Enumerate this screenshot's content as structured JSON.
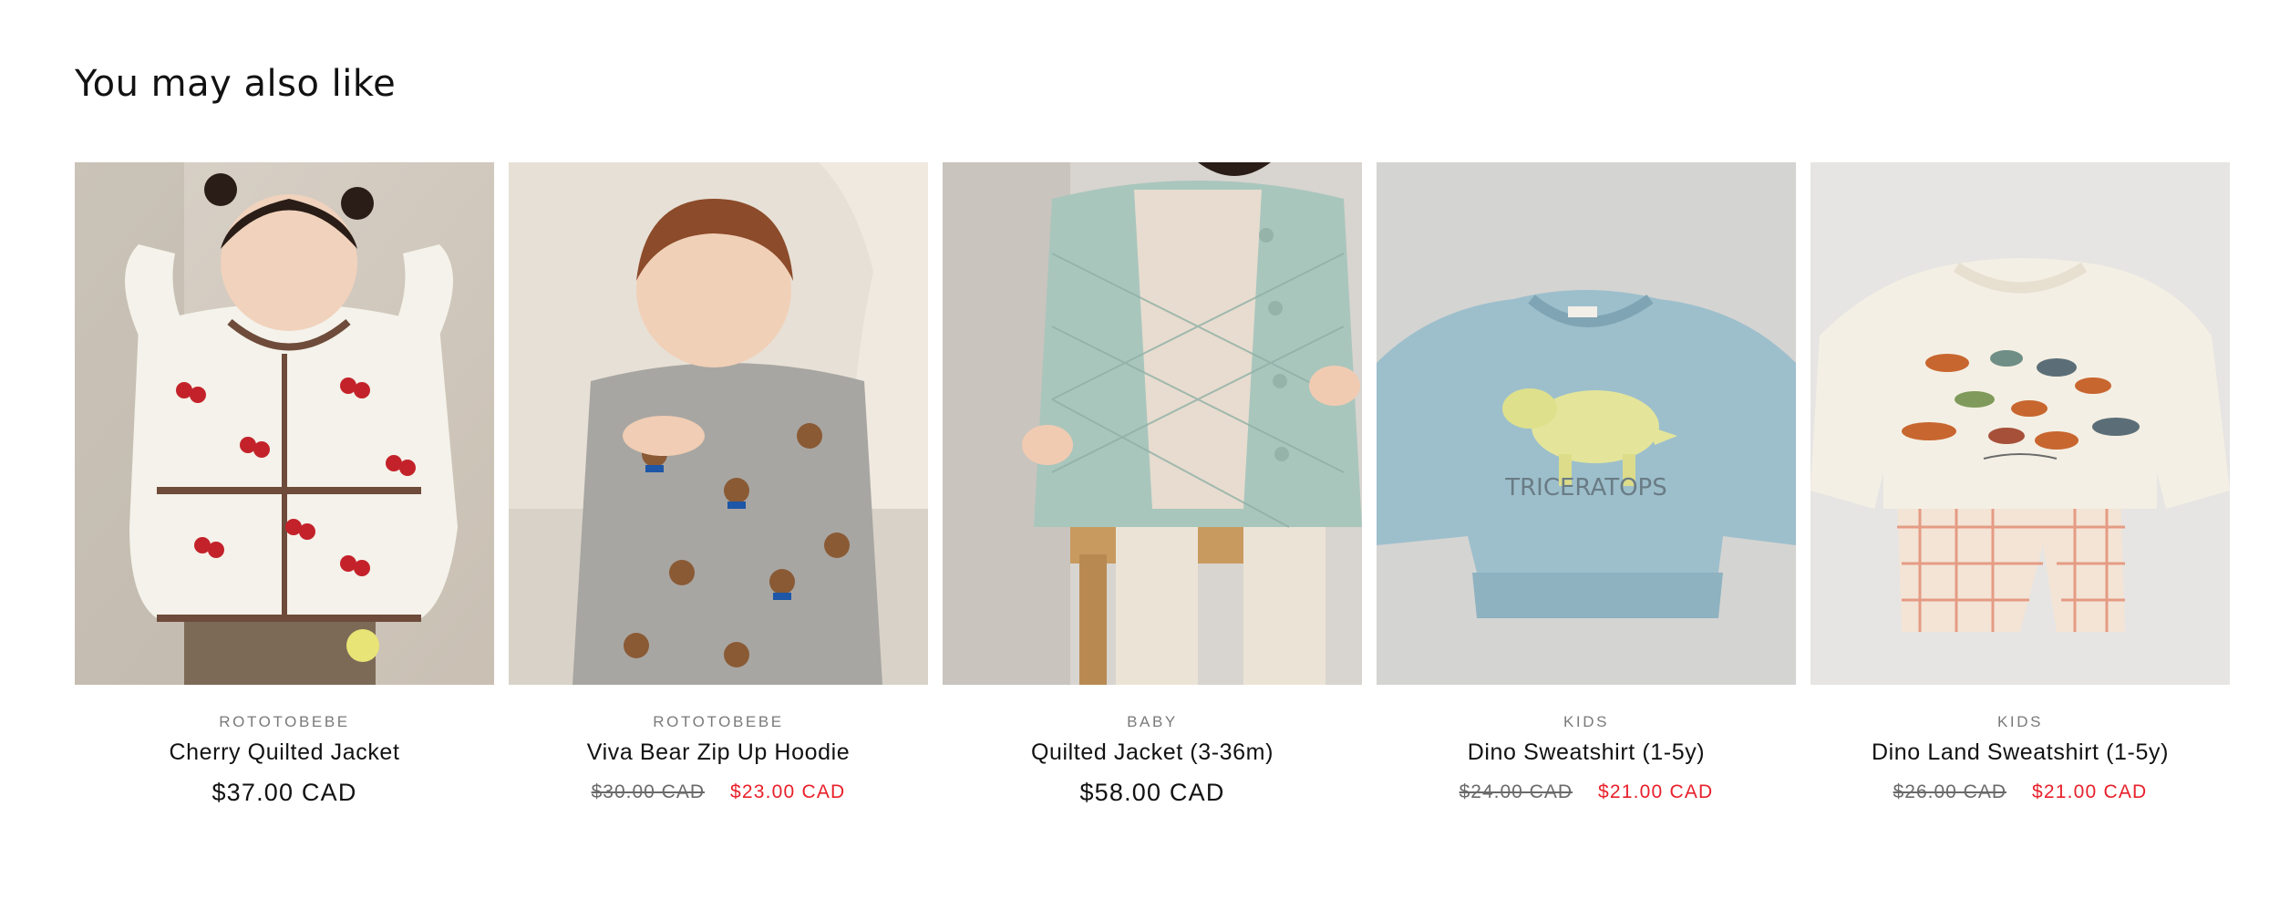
{
  "section": {
    "heading": "You may also like"
  },
  "products": [
    {
      "vendor": "ROTOTOBEBE",
      "title": "Cherry Quilted Jacket",
      "price": "$37.00 CAD",
      "compare_price": null,
      "sale_price": null,
      "image": "baby-in-cherry-quilted-jacket-photo"
    },
    {
      "vendor": "ROTOTOBEBE",
      "title": "Viva Bear Zip Up Hoodie",
      "price": null,
      "compare_price": "$30.00 CAD",
      "sale_price": "$23.00 CAD",
      "image": "toddler-in-grey-bear-hoodie-photo"
    },
    {
      "vendor": "BABY",
      "title": "Quilted Jacket (3-36m)",
      "price": "$58.00 CAD",
      "compare_price": null,
      "sale_price": null,
      "image": "child-in-mint-quilted-jacket-photo"
    },
    {
      "vendor": "KIDS",
      "title": "Dino Sweatshirt (1-5y)",
      "price": null,
      "compare_price": "$24.00 CAD",
      "sale_price": "$21.00 CAD",
      "image": "blue-dino-sweatshirt-flatlay-photo",
      "graphic_text": "TRICERATOPS"
    },
    {
      "vendor": "KIDS",
      "title": "Dino Land Sweatshirt (1-5y)",
      "price": null,
      "compare_price": "$26.00 CAD",
      "sale_price": "$21.00 CAD",
      "image": "cream-dino-sweatshirt-with-plaid-pants-photo"
    }
  ],
  "colors": {
    "sale": "#e8202a",
    "text": "#121212",
    "muted": "#7a7a7a"
  }
}
